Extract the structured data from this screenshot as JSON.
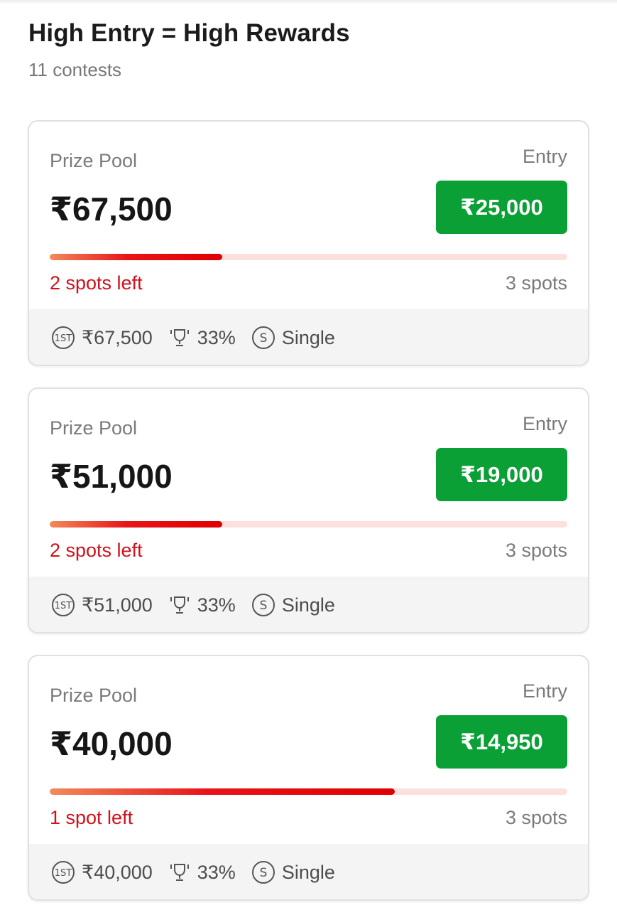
{
  "section": {
    "title": "High Entry = High Rewards",
    "subtitle": "11 contests"
  },
  "colors": {
    "entry_button": "#0aa035",
    "spots_left_text": "#d0101a",
    "progress_track": "#fde0de"
  },
  "contests": [
    {
      "prize_pool_label": "Prize Pool",
      "prize_pool": "₹67,500",
      "entry_label": "Entry",
      "entry_fee": "₹25,000",
      "spots_left": "2 spots left",
      "total_spots": "3 spots",
      "fill_fraction": 0.333,
      "first_prize": "₹67,500",
      "win_percent": "33%",
      "entry_type": "Single",
      "icons": [
        "first-prize-icon",
        "trophy-icon",
        "single-entry-icon"
      ]
    },
    {
      "prize_pool_label": "Prize Pool",
      "prize_pool": "₹51,000",
      "entry_label": "Entry",
      "entry_fee": "₹19,000",
      "spots_left": "2 spots left",
      "total_spots": "3 spots",
      "fill_fraction": 0.333,
      "first_prize": "₹51,000",
      "win_percent": "33%",
      "entry_type": "Single",
      "icons": [
        "first-prize-icon",
        "trophy-icon",
        "single-entry-icon"
      ]
    },
    {
      "prize_pool_label": "Prize Pool",
      "prize_pool": "₹40,000",
      "entry_label": "Entry",
      "entry_fee": "₹14,950",
      "spots_left": "1 spot left",
      "total_spots": "3 spots",
      "fill_fraction": 0.667,
      "first_prize": "₹40,000",
      "win_percent": "33%",
      "entry_type": "Single",
      "icons": [
        "first-prize-icon",
        "trophy-icon",
        "single-entry-icon"
      ]
    }
  ]
}
